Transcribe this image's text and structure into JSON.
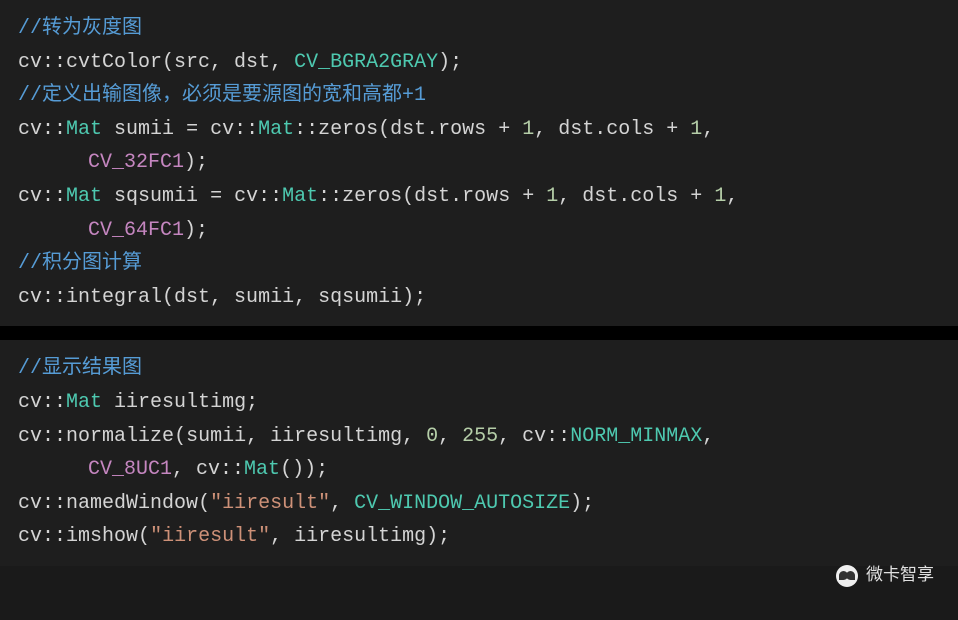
{
  "block1": {
    "comment1": "//转为灰度图",
    "line2_p1": "cv",
    "line2_p2": "::",
    "line2_p3": "cvtColor",
    "line2_p4": "(src, dst, ",
    "line2_p5": "CV_BGRA2GRAY",
    "line2_p6": ");",
    "comment2": "//定义出输图像，必须是要源图的宽和高都+1",
    "line4_p1": "cv",
    "line4_p2": "::",
    "line4_p3": "Mat",
    "line4_p4": " sumii ",
    "line4_p5": "=",
    "line4_p6": " cv",
    "line4_p7": "::",
    "line4_p8": "Mat",
    "line4_p9": "::",
    "line4_p10": "zeros",
    "line4_p11": "(dst.rows ",
    "line4_p12": "+",
    "line4_p13": " ",
    "line4_p14": "1",
    "line4_p15": ", dst.cols ",
    "line4_p16": "+",
    "line4_p17": " ",
    "line4_p18": "1",
    "line4_p19": ",",
    "line5_p1": "CV_32FC1",
    "line5_p2": ");",
    "line6_p1": "cv",
    "line6_p2": "::",
    "line6_p3": "Mat",
    "line6_p4": " sqsumii ",
    "line6_p5": "=",
    "line6_p6": " cv",
    "line6_p7": "::",
    "line6_p8": "Mat",
    "line6_p9": "::",
    "line6_p10": "zeros",
    "line6_p11": "(dst.rows ",
    "line6_p12": "+",
    "line6_p13": " ",
    "line6_p14": "1",
    "line6_p15": ", dst.cols ",
    "line6_p16": "+",
    "line6_p17": " ",
    "line6_p18": "1",
    "line6_p19": ",",
    "line7_p1": "CV_64FC1",
    "line7_p2": ");",
    "comment3": "//积分图计算",
    "line9_p1": "cv",
    "line9_p2": "::",
    "line9_p3": "integral",
    "line9_p4": "(dst, sumii, sqsumii);"
  },
  "block2": {
    "comment1": "//显示结果图",
    "line2_p1": "cv",
    "line2_p2": "::",
    "line2_p3": "Mat",
    "line2_p4": " iiresultimg;",
    "line3_p1": "cv",
    "line3_p2": "::",
    "line3_p3": "normalize",
    "line3_p4": "(sumii, iiresultimg, ",
    "line3_p5": "0",
    "line3_p6": ", ",
    "line3_p7": "255",
    "line3_p8": ", cv",
    "line3_p9": "::",
    "line3_p10": "NORM_MINMAX",
    "line3_p11": ",",
    "line4_p1": "CV_8UC1",
    "line4_p2": ", cv",
    "line4_p3": "::",
    "line4_p4": "Mat",
    "line4_p5": "());",
    "line5_p1": "cv",
    "line5_p2": "::",
    "line5_p3": "namedWindow",
    "line5_p4": "(",
    "line5_p5": "\"iiresult\"",
    "line5_p6": ", ",
    "line5_p7": "CV_WINDOW_AUTOSIZE",
    "line5_p8": ");",
    "line6_p1": "cv",
    "line6_p2": "::",
    "line6_p3": "imshow",
    "line6_p4": "(",
    "line6_p5": "\"iiresult\"",
    "line6_p6": ", iiresultimg);"
  },
  "watermark": {
    "text": "微卡智享"
  }
}
